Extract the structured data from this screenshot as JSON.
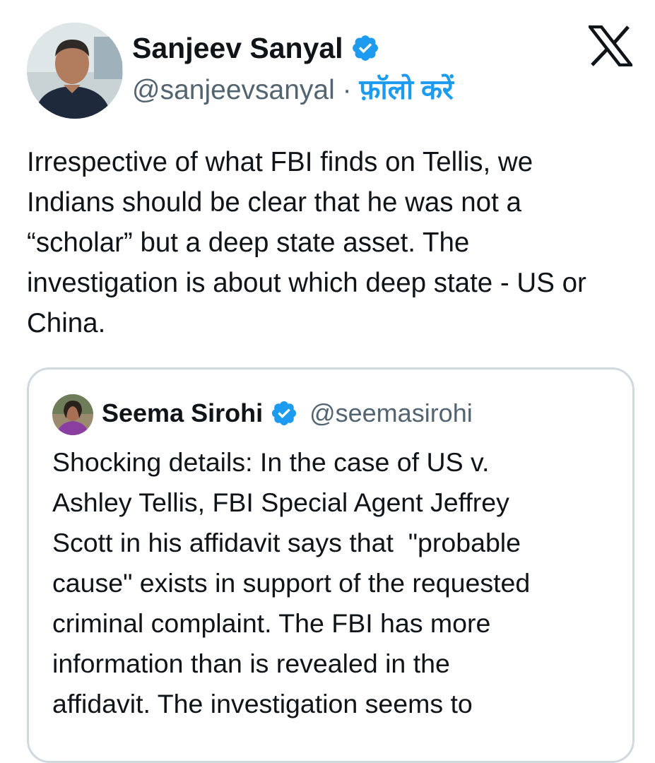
{
  "header": {
    "author_name": "Sanjeev Sanyal",
    "author_handle": "@sanjeevsanyal",
    "separator": " · ",
    "follow_label": "फ़ॉलो करें"
  },
  "tweet": {
    "text": "Irrespective of what FBI finds on Tellis, we\nIndians should be clear that he was not a\n“scholar” but a deep state asset. The\ninvestigation is about which deep state - US or\nChina."
  },
  "quoted_tweet": {
    "author_name": "Seema Sirohi",
    "author_handle": "@seemasirohi",
    "text": "Shocking details: In the case of US v.\nAshley Tellis, FBI Special Agent Jeffrey\nScott in his affidavit says that  \"probable\ncause\" exists in support of the requested\ncriminal complaint. The FBI has more\ninformation than is revealed in the\naffidavit. The investigation seems to"
  },
  "icons": {
    "verified": "verified-badge-icon",
    "logo": "x-logo-icon"
  },
  "colors": {
    "accent": "#1d9bf0",
    "text": "#0f1419",
    "muted": "#536471",
    "border": "#cfd9de"
  }
}
